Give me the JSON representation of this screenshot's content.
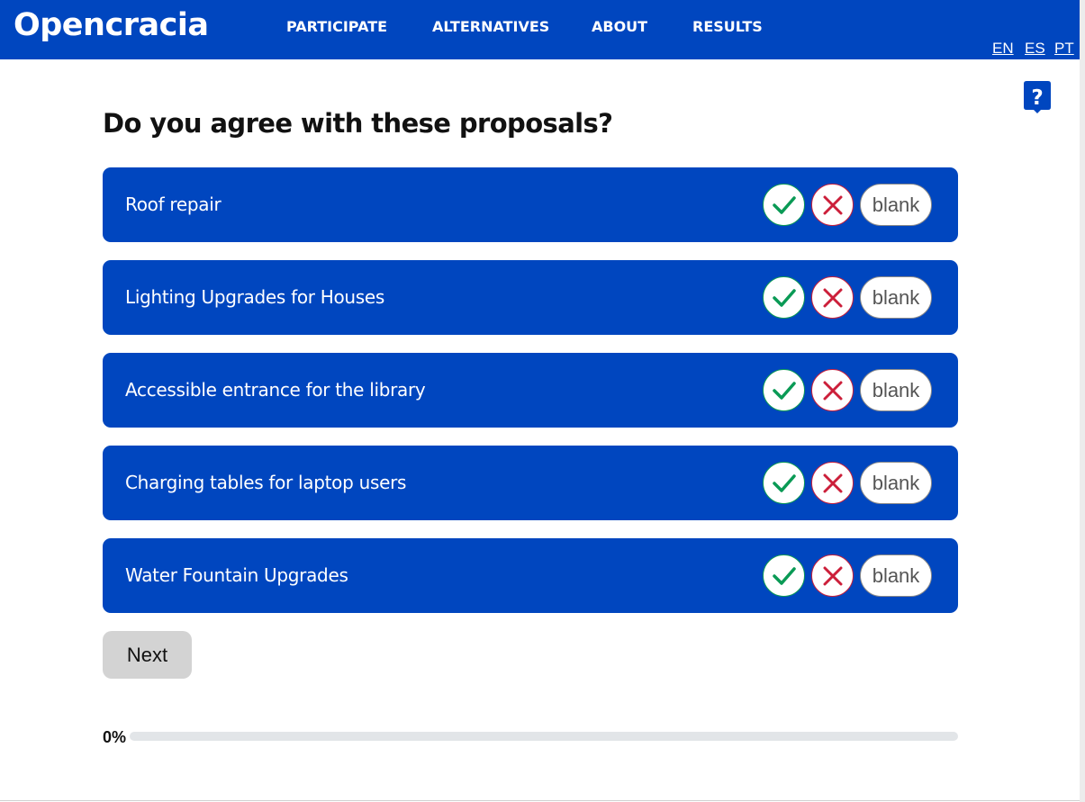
{
  "header": {
    "brand": "Opencracia",
    "nav": [
      "PARTICIPATE",
      "ALTERNATIVES",
      "ABOUT",
      "RESULTS"
    ],
    "languages": [
      "EN",
      "ES",
      "PT"
    ]
  },
  "main": {
    "title": "Do you agree with these proposals?",
    "proposals": [
      {
        "label": "Roof repair",
        "blank_label": "blank"
      },
      {
        "label": "Lighting Upgrades for Houses",
        "blank_label": "blank"
      },
      {
        "label": "Accessible entrance for the library",
        "blank_label": "blank"
      },
      {
        "label": "Charging tables for laptop users",
        "blank_label": "blank"
      },
      {
        "label": "Water Fountain Upgrades",
        "blank_label": "blank"
      }
    ],
    "next_label": "Next",
    "progress": {
      "label": "0%",
      "value": 0
    }
  },
  "colors": {
    "primary": "#0046bf",
    "yes": "#0a9a55",
    "no": "#cc1f3a",
    "next_bg": "#d3d3d3",
    "progress_track": "#e2e5e8"
  },
  "icons": {
    "yes": "check-icon",
    "no": "x-icon",
    "help": "question-speech-icon"
  }
}
